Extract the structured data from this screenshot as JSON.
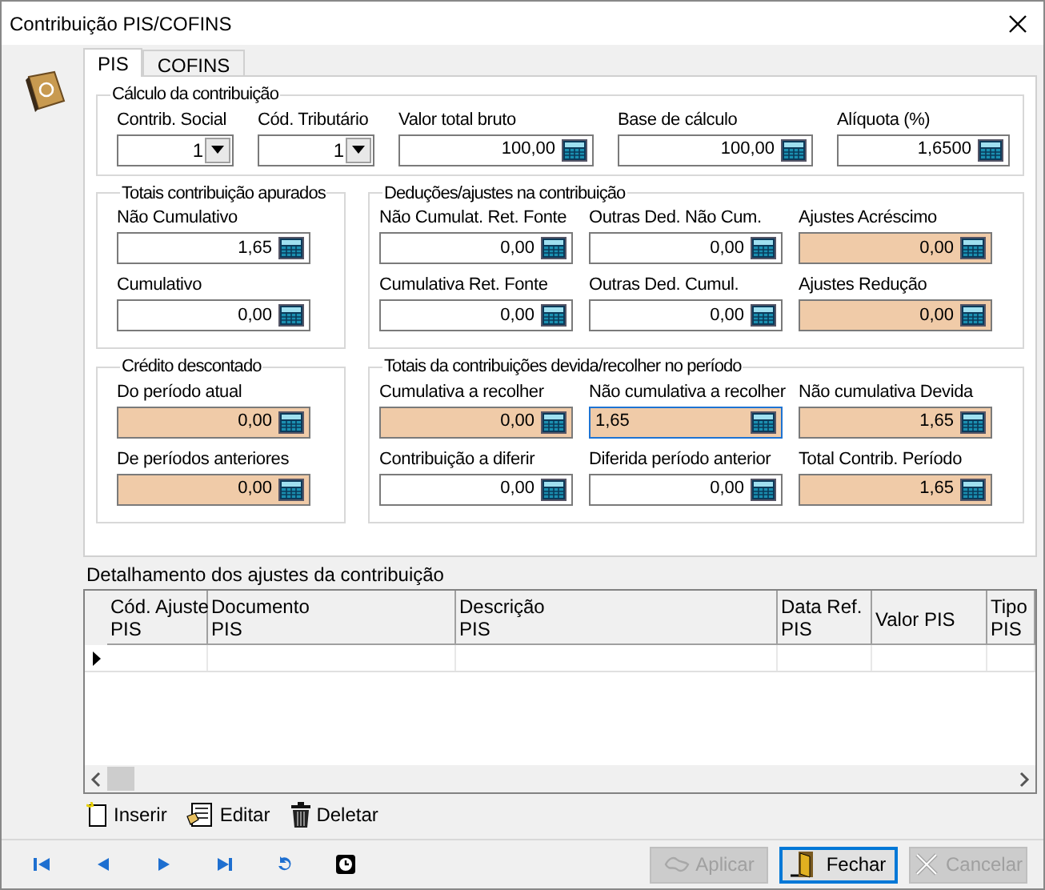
{
  "window": {
    "title": "Contribuição PIS/COFINS"
  },
  "tabs": [
    {
      "label": "PIS",
      "selected": true
    },
    {
      "label": "COFINS",
      "selected": false
    }
  ],
  "groups": [
    {
      "title": "Cálculo da contribuição",
      "fields": [
        {
          "label": "Contrib. Social",
          "value": "1",
          "kind": "combo"
        },
        {
          "label": "Cód. Tributário",
          "value": "1",
          "kind": "combo"
        },
        {
          "label": "Valor total bruto",
          "value": "100,00",
          "kind": "calc",
          "shaded": false,
          "focused": false
        },
        {
          "label": "Base de cálculo",
          "value": "100,00",
          "kind": "calc",
          "shaded": false,
          "focused": false
        },
        {
          "label": "Alíquota (%)",
          "value": "1,6500",
          "kind": "calc",
          "shaded": false,
          "focused": false
        }
      ]
    },
    {
      "title": "Totais contribuição apurados",
      "fields": [
        {
          "label": "Não Cumulativo",
          "value": "1,65",
          "kind": "calc",
          "shaded": false,
          "focused": false
        },
        {
          "label": "Cumulativo",
          "value": "0,00",
          "kind": "calc",
          "shaded": false,
          "focused": false
        }
      ]
    },
    {
      "title": "Deduções/ajustes na contribuição",
      "fields": [
        {
          "label": "Não Cumulat. Ret. Fonte",
          "value": "0,00",
          "kind": "calc",
          "shaded": false,
          "focused": false
        },
        {
          "label": "Outras Ded. Não Cum.",
          "value": "0,00",
          "kind": "calc",
          "shaded": false,
          "focused": false
        },
        {
          "label": "Ajustes Acréscimo",
          "value": "0,00",
          "kind": "calc",
          "shaded": true,
          "focused": false
        },
        {
          "label": "Cumulativa Ret. Fonte",
          "value": "0,00",
          "kind": "calc",
          "shaded": false,
          "focused": false
        },
        {
          "label": "Outras Ded. Cumul.",
          "value": "0,00",
          "kind": "calc",
          "shaded": false,
          "focused": false
        },
        {
          "label": "Ajustes Redução",
          "value": "0,00",
          "kind": "calc",
          "shaded": true,
          "focused": false
        }
      ]
    },
    {
      "title": "Crédito descontado",
      "fields": [
        {
          "label": "Do período atual",
          "value": "0,00",
          "kind": "calc",
          "shaded": true,
          "focused": false
        },
        {
          "label": "De períodos anteriores",
          "value": "0,00",
          "kind": "calc",
          "shaded": true,
          "focused": false
        }
      ]
    },
    {
      "title": "Totais da contribuições devida/recolher no período",
      "fields": [
        {
          "label": "Cumulativa a recolher",
          "value": "0,00",
          "kind": "calc",
          "shaded": true,
          "focused": false
        },
        {
          "label": "Não cumulativa a recolher",
          "value": "1,65",
          "kind": "calc",
          "shaded": true,
          "focused": true
        },
        {
          "label": "Não cumulativa Devida",
          "value": "1,65",
          "kind": "calc",
          "shaded": true,
          "focused": false
        },
        {
          "label": "Contribuição a diferir",
          "value": "0,00",
          "kind": "calc",
          "shaded": false,
          "focused": false
        },
        {
          "label": "Diferida período anterior",
          "value": "0,00",
          "kind": "calc",
          "shaded": false,
          "focused": false
        },
        {
          "label": "Total Contrib. Período",
          "value": "1,65",
          "kind": "calc",
          "shaded": true,
          "focused": false
        }
      ]
    }
  ],
  "details": {
    "title": "Detalhamento dos ajustes da contribuição",
    "columns": [
      {
        "lines": [
          "Cód. Ajuste",
          "PIS"
        ]
      },
      {
        "lines": [
          "Documento",
          "PIS"
        ]
      },
      {
        "lines": [
          "Descrição",
          "PIS"
        ]
      },
      {
        "lines": [
          "Data Ref.",
          "PIS"
        ]
      },
      {
        "lines": [
          "Valor PIS"
        ]
      },
      {
        "lines": [
          "Tipo",
          "PIS"
        ]
      }
    ]
  },
  "actions": [
    {
      "label": "Inserir",
      "kind": "insert"
    },
    {
      "label": "Editar",
      "kind": "edit"
    },
    {
      "label": "Deletar",
      "kind": "delete"
    }
  ],
  "buttons": [
    {
      "label": "Aplicar",
      "kind": "apply",
      "disabled": true,
      "default": false
    },
    {
      "label": "Fechar",
      "kind": "close",
      "disabled": false,
      "default": true
    },
    {
      "label": "Cancelar",
      "kind": "cancel",
      "disabled": true,
      "default": false
    }
  ]
}
